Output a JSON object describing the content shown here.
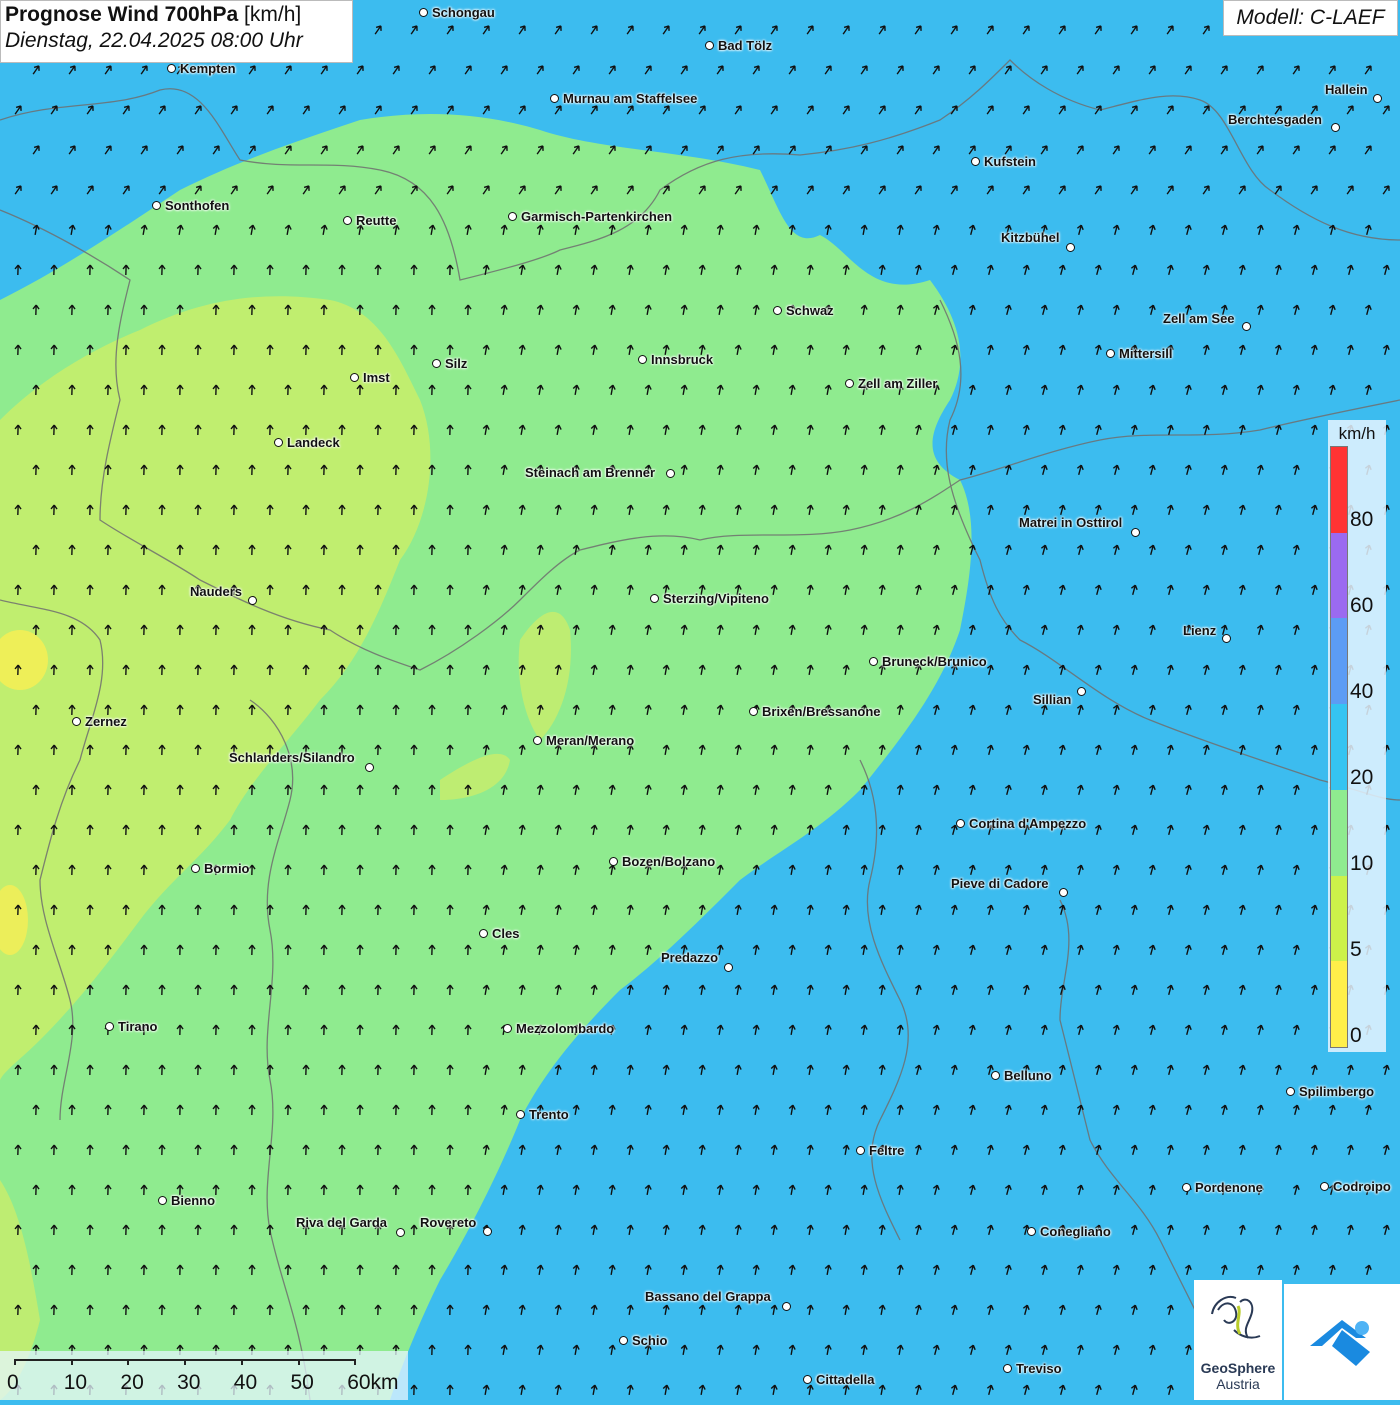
{
  "header": {
    "title_bold": "Prognose Wind 700hPa",
    "title_unit": " [km/h]",
    "date_time": "Dienstag, 22.04.2025 08:00 Uhr"
  },
  "model": {
    "label": "Modell: C-LAEF"
  },
  "legend": {
    "unit": "km/h",
    "labels": [
      "80",
      "60",
      "40",
      "20",
      "10",
      "5",
      "0"
    ],
    "colors": [
      "#ff3333",
      "#9b6af0",
      "#5c9cf5",
      "#35c4f2",
      "#8feb8f",
      "#cdf24a",
      "#ffef4a"
    ]
  },
  "scale_bar": {
    "labels": [
      "0",
      "10",
      "20",
      "30",
      "40",
      "50",
      "60km"
    ]
  },
  "logo": {
    "line1": "GeoSphere",
    "line2": "Austria"
  },
  "cities": [
    {
      "name": "Schongau"
    },
    {
      "name": "Bad Tölz"
    },
    {
      "name": "Kempten"
    },
    {
      "name": "Murnau am Staffelsee"
    },
    {
      "name": "Hallein"
    },
    {
      "name": "Berchtesgaden"
    },
    {
      "name": "Kufstein"
    },
    {
      "name": "Sonthofen"
    },
    {
      "name": "Reutte"
    },
    {
      "name": "Garmisch-Partenkirchen"
    },
    {
      "name": "Kitzbühel"
    },
    {
      "name": "Schwaz"
    },
    {
      "name": "Zell am See"
    },
    {
      "name": "Mittersill"
    },
    {
      "name": "Innsbruck"
    },
    {
      "name": "Silz"
    },
    {
      "name": "Imst"
    },
    {
      "name": "Zell am Ziller"
    },
    {
      "name": "Landeck"
    },
    {
      "name": "Steinach am Brenner"
    },
    {
      "name": "Matrei in Osttirol"
    },
    {
      "name": "Nauders"
    },
    {
      "name": "Sterzing/Vipiteno"
    },
    {
      "name": "Lienz"
    },
    {
      "name": "Bruneck/Brunico"
    },
    {
      "name": "Sillian"
    },
    {
      "name": "Brixen/Bressanone"
    },
    {
      "name": "Zernez"
    },
    {
      "name": "Meran/Merano"
    },
    {
      "name": "Schlanders/Silandro"
    },
    {
      "name": "Cortina d'Ampezzo"
    },
    {
      "name": "Bozen/Bolzano"
    },
    {
      "name": "Bormio"
    },
    {
      "name": "Pieve di Cadore"
    },
    {
      "name": "Cles"
    },
    {
      "name": "Predazzo"
    },
    {
      "name": "Tirano"
    },
    {
      "name": "Mezzolombardo"
    },
    {
      "name": "Belluno"
    },
    {
      "name": "Spilimbergo"
    },
    {
      "name": "Trento"
    },
    {
      "name": "Feltre"
    },
    {
      "name": "Pordenone"
    },
    {
      "name": "Codroipo"
    },
    {
      "name": "Bienno"
    },
    {
      "name": "Riva del Garda"
    },
    {
      "name": "Rovereto"
    },
    {
      "name": "Conegliano"
    },
    {
      "name": "Bassano del Grappa"
    },
    {
      "name": "Schio"
    },
    {
      "name": "Treviso"
    },
    {
      "name": "Cittadella"
    }
  ]
}
